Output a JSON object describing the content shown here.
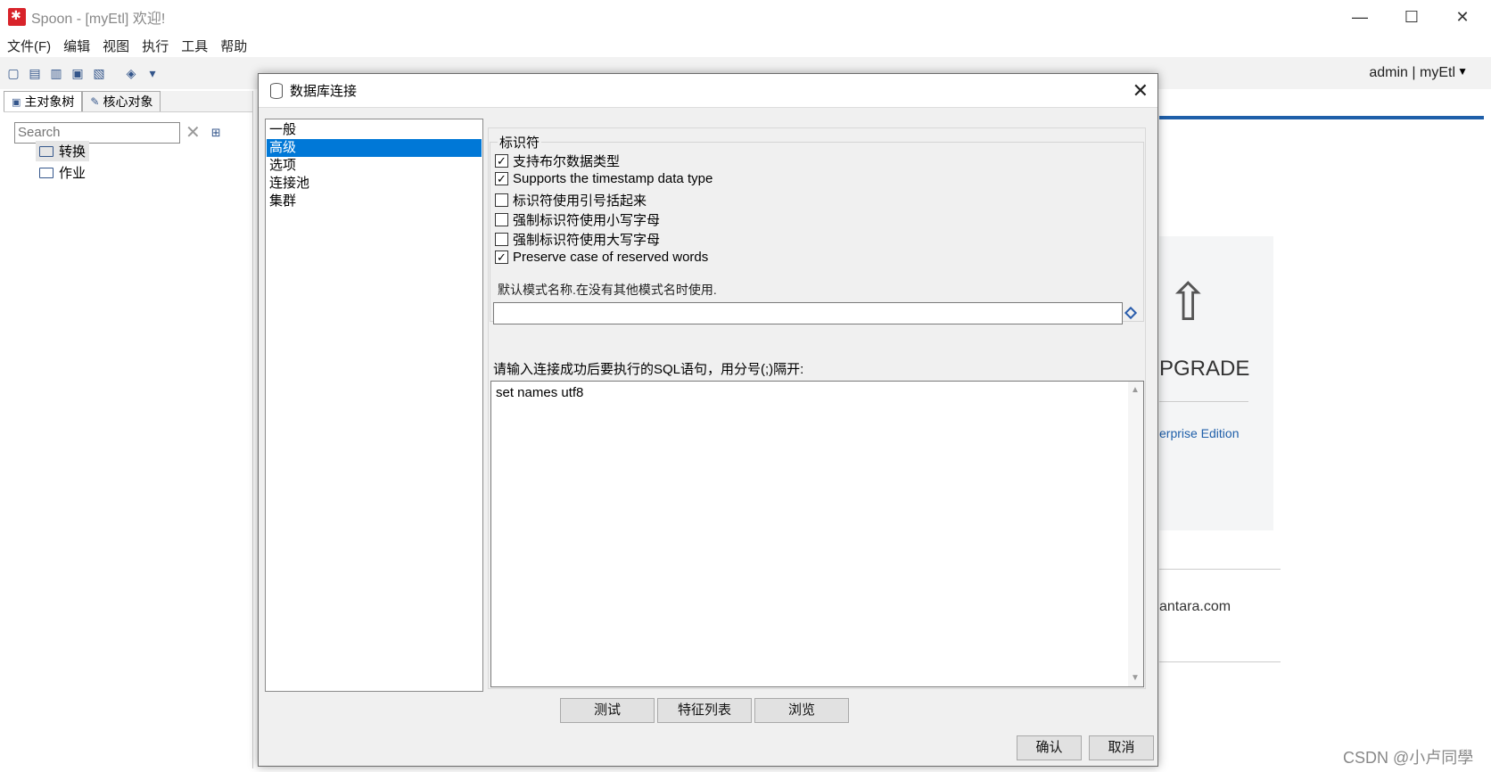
{
  "window": {
    "title": "Spoon - [myEtl] 欢迎!",
    "minimize": "—",
    "maximize": "☐",
    "close": "✕"
  },
  "menu": [
    "文件(F)",
    "编辑",
    "视图",
    "执行",
    "工具",
    "帮助"
  ],
  "toolbar": {
    "user": "admin  |  myEtl",
    "caret": "▼"
  },
  "left_panel": {
    "tabs": [
      "主对象树",
      "核心对象"
    ],
    "search_placeholder": "Search",
    "clear": "✕",
    "tree": [
      "转换",
      "作业"
    ]
  },
  "background": {
    "upgrade_text": "PGRADE",
    "edition_link": "erprise Edition",
    "domain_text": "antara.com",
    "watermark": "CSDN @小卢同學"
  },
  "dialog": {
    "title": "数据库连接",
    "close": "✕",
    "nav": [
      "一般",
      "高级",
      "选项",
      "连接池",
      "集群"
    ],
    "selected_nav": "高级",
    "group_legend": "标识符",
    "checkboxes": [
      {
        "label": "支持布尔数据类型",
        "checked": true
      },
      {
        "label": "Supports the timestamp data type",
        "checked": true
      },
      {
        "label": "标识符使用引号括起来",
        "checked": false
      },
      {
        "label": "强制标识符使用小写字母",
        "checked": false
      },
      {
        "label": "强制标识符使用大写字母",
        "checked": false
      },
      {
        "label": "Preserve case of reserved words",
        "checked": true
      }
    ],
    "schema_label": "默认模式名称.在没有其他模式名时使用.",
    "schema_value": "",
    "sql_label": "请输入连接成功后要执行的SQL语句，用分号(;)隔开:",
    "sql_value": "set names utf8",
    "buttons": {
      "test": "测试",
      "feature_list": "特征列表",
      "browse": "浏览",
      "ok": "确认",
      "cancel": "取消"
    }
  }
}
